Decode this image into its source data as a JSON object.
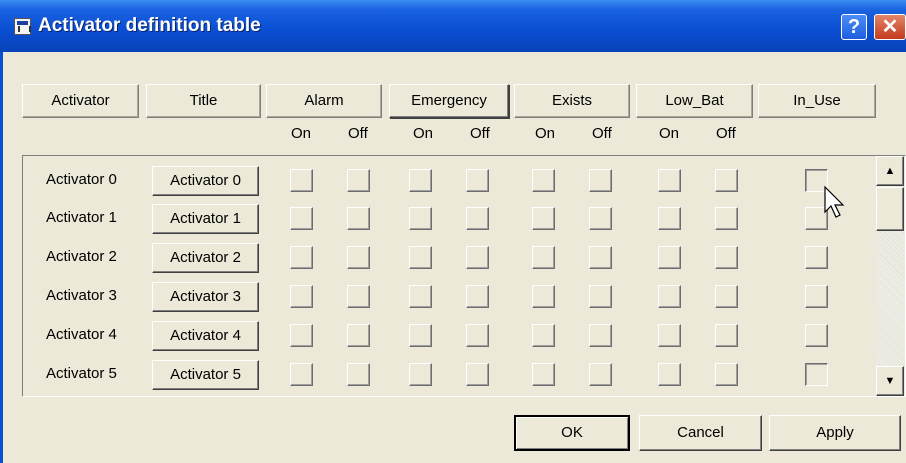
{
  "window": {
    "title": "Activator definition table",
    "help_glyph": "?",
    "close_glyph": "✕"
  },
  "headers": [
    "Activator",
    "Title",
    "Alarm",
    "Emergency",
    "Exists",
    "Low_Bat",
    "In_Use"
  ],
  "sub_headers": [
    "On",
    "Off",
    "On",
    "Off",
    "On",
    "Off",
    "On",
    "Off"
  ],
  "rows": [
    {
      "label": "Activator 0",
      "title": "Activator 0",
      "checks": [
        false,
        false,
        false,
        false,
        false,
        false,
        false,
        false
      ],
      "in_use": false
    },
    {
      "label": "Activator 1",
      "title": "Activator 1",
      "checks": [
        false,
        false,
        false,
        false,
        false,
        false,
        false,
        false
      ],
      "in_use": false
    },
    {
      "label": "Activator 2",
      "title": "Activator 2",
      "checks": [
        false,
        false,
        false,
        false,
        false,
        false,
        false,
        false
      ],
      "in_use": false
    },
    {
      "label": "Activator 3",
      "title": "Activator 3",
      "checks": [
        false,
        false,
        false,
        false,
        false,
        false,
        false,
        false
      ],
      "in_use": false
    },
    {
      "label": "Activator 4",
      "title": "Activator 4",
      "checks": [
        false,
        false,
        false,
        false,
        false,
        false,
        false,
        false
      ],
      "in_use": false
    },
    {
      "label": "Activator 5",
      "title": "Activator 5",
      "checks": [
        false,
        false,
        false,
        false,
        false,
        false,
        false,
        false
      ],
      "in_use": false
    }
  ],
  "scrollbar": {
    "up_icon": "▲",
    "down_icon": "▼"
  },
  "buttons": {
    "ok": "OK",
    "cancel": "Cancel",
    "apply": "Apply"
  },
  "icons": {
    "app": "activator-app-icon",
    "cursor": "mouse-pointer-icon"
  },
  "colors": {
    "title_bar": "#0a4fd4",
    "dialog_bg": "#ece9d8",
    "close_button": "#c4391c"
  }
}
